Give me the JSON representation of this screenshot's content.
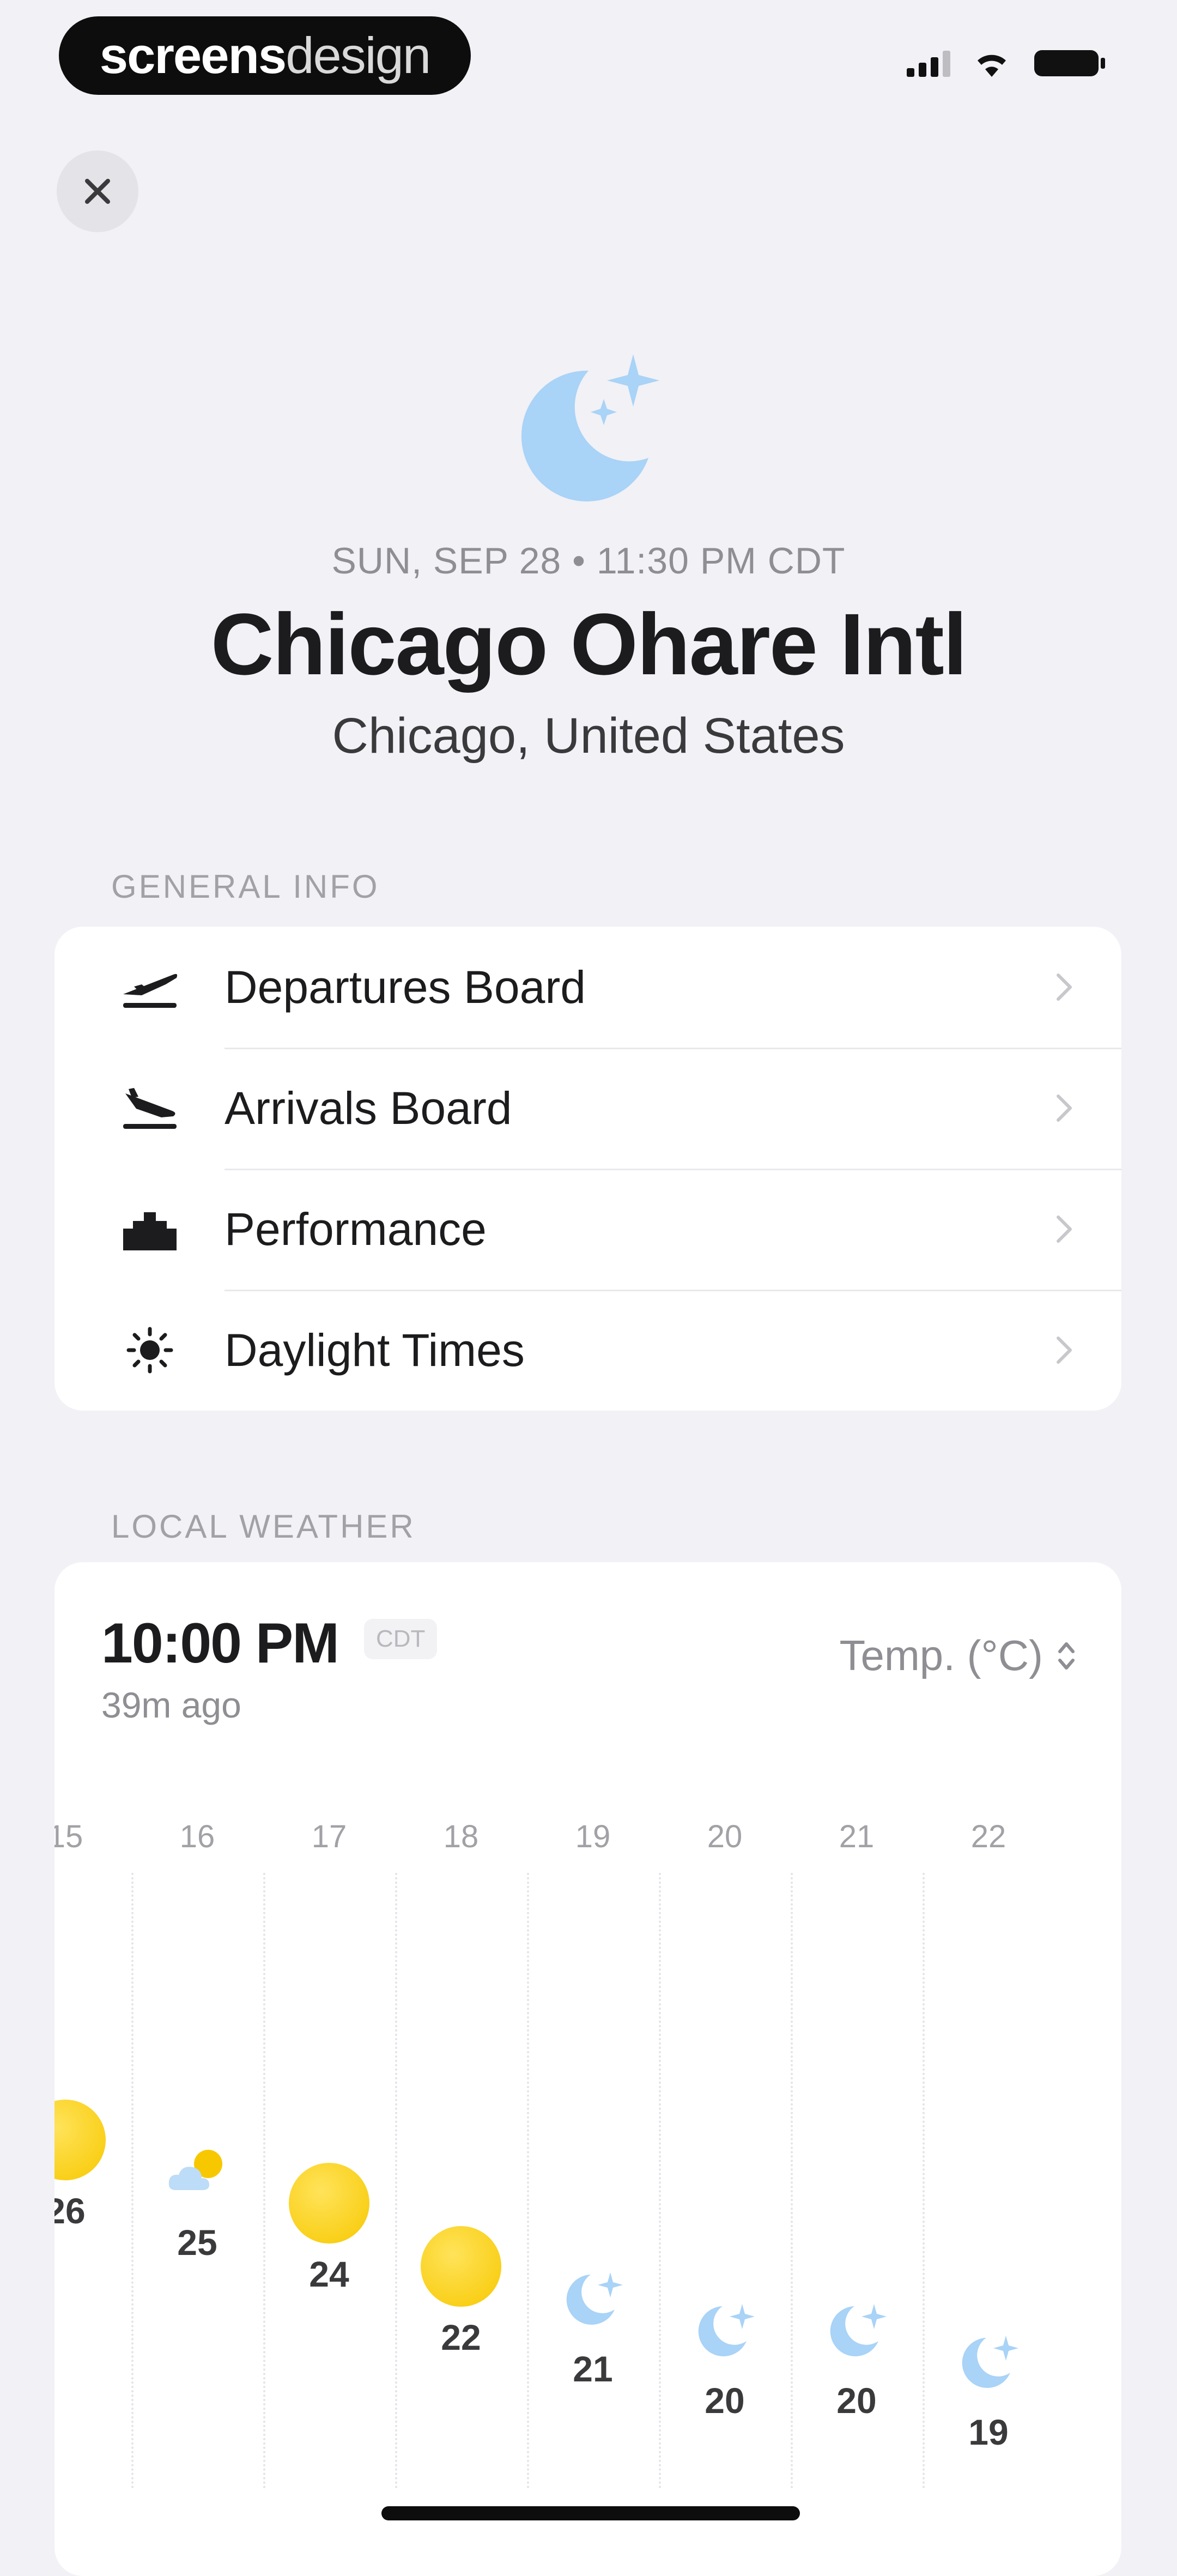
{
  "status_bar": {
    "brand_a": "screens",
    "brand_b": "design"
  },
  "header": {
    "datetime": "SUN, SEP 28 • 11:30 PM CDT",
    "airport_name": "Chicago Ohare Intl",
    "airport_city": "Chicago, United States"
  },
  "general_info": {
    "section_label": "GENERAL INFO",
    "items": [
      {
        "label": "Departures Board",
        "icon": "plane-departure-icon"
      },
      {
        "label": "Arrivals Board",
        "icon": "plane-arrival-icon"
      },
      {
        "label": "Performance",
        "icon": "performance-icon"
      },
      {
        "label": "Daylight Times",
        "icon": "sun-icon"
      }
    ]
  },
  "local_weather": {
    "section_label": "LOCAL WEATHER",
    "time": "10:00 PM",
    "timezone": "CDT",
    "ago": "39m ago",
    "metric": "Temp. (°C)",
    "hours": [
      {
        "hour": "15",
        "temp": "26",
        "condition": "sun"
      },
      {
        "hour": "16",
        "temp": "25",
        "condition": "partly-cloudy"
      },
      {
        "hour": "17",
        "temp": "24",
        "condition": "sun"
      },
      {
        "hour": "18",
        "temp": "22",
        "condition": "sun"
      },
      {
        "hour": "19",
        "temp": "21",
        "condition": "moon"
      },
      {
        "hour": "20",
        "temp": "20",
        "condition": "moon"
      },
      {
        "hour": "21",
        "temp": "20",
        "condition": "moon"
      },
      {
        "hour": "22",
        "temp": "19",
        "condition": "moon"
      }
    ]
  },
  "colors": {
    "accent_moon": "#a9d3f7",
    "sun": "#f7c800",
    "background": "#f1f1f6"
  }
}
